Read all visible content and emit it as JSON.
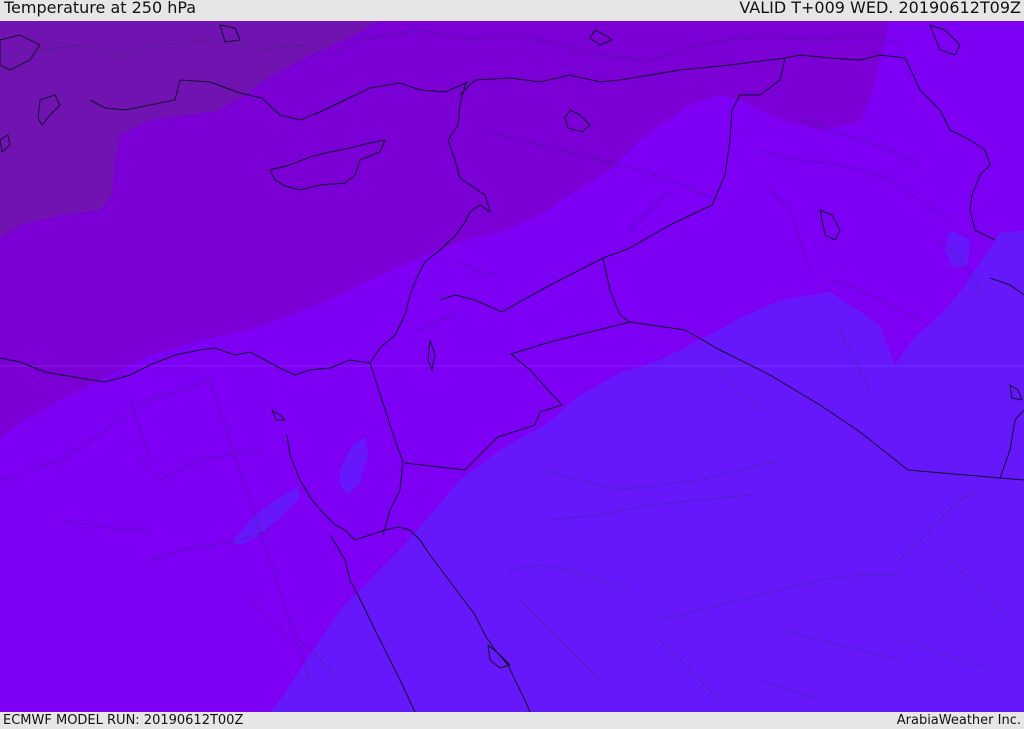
{
  "header": {
    "title": "Temperature at 250 hPa",
    "valid": "VALID T+009 WED. 20190612T09Z"
  },
  "footer": {
    "model_run": "ECMWF MODEL RUN: 20190612T00Z",
    "credit": "ArabiaWeather Inc."
  },
  "map": {
    "region": "Eastern Mediterranean / Middle East",
    "colors": {
      "band_darkest": "#7013b0",
      "band_dark": "#7a00d6",
      "band_mid": "#7d00f5",
      "band_light": "#6618fb",
      "border_line": "#101030",
      "internal_border": "#2a2a60"
    }
  }
}
